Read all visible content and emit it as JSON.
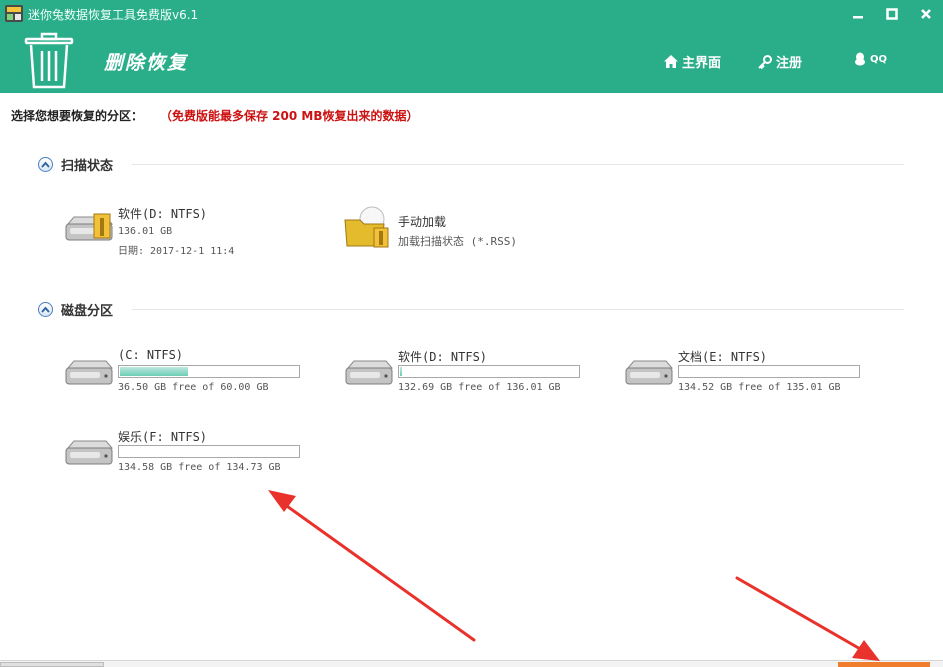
{
  "window": {
    "title": "迷你兔数据恢复工具免费版v6.1",
    "minimize_icon": "minimize-icon",
    "maximize_icon": "maximize-icon",
    "close_icon": "close-icon"
  },
  "header": {
    "app_name": "删除恢复",
    "nav": {
      "home": "主界面",
      "register": "注册",
      "qq": "QQ"
    }
  },
  "main": {
    "select_label": "选择您想要恢复的分区：",
    "select_note": "（免费版能最多保存 200 MB恢复出来的数据）",
    "scan_section": {
      "title": "扫描状态",
      "items": [
        {
          "name": "软件(D: NTFS)",
          "size": "136.01 GB",
          "date": "日期: 2017-12-1 11:4"
        },
        {
          "name": "手动加载",
          "desc": "加载扫描状态 (*.RSS)"
        }
      ]
    },
    "disk_section": {
      "title": "磁盘分区",
      "partitions": [
        {
          "name": "(C: NTFS)",
          "usage": "36.50 GB free of 60.00 GB",
          "used_fraction": 0.39
        },
        {
          "name": "软件(D: NTFS)",
          "usage": "132.69 GB free of 136.01 GB",
          "used_fraction": 0.024
        },
        {
          "name": "文档(E: NTFS)",
          "usage": "134.52 GB free of 135.01 GB",
          "used_fraction": 0.004
        },
        {
          "name": "娱乐(F: NTFS)",
          "usage": "134.58 GB free of 134.73 GB",
          "used_fraction": 0.001
        }
      ]
    }
  },
  "colors": {
    "accent": "#2aae8a",
    "note_red": "#cc1111",
    "arrow_red": "#e8322b",
    "bar_fill": "#6ccdb4",
    "bottom_button": "#f07c2d"
  }
}
